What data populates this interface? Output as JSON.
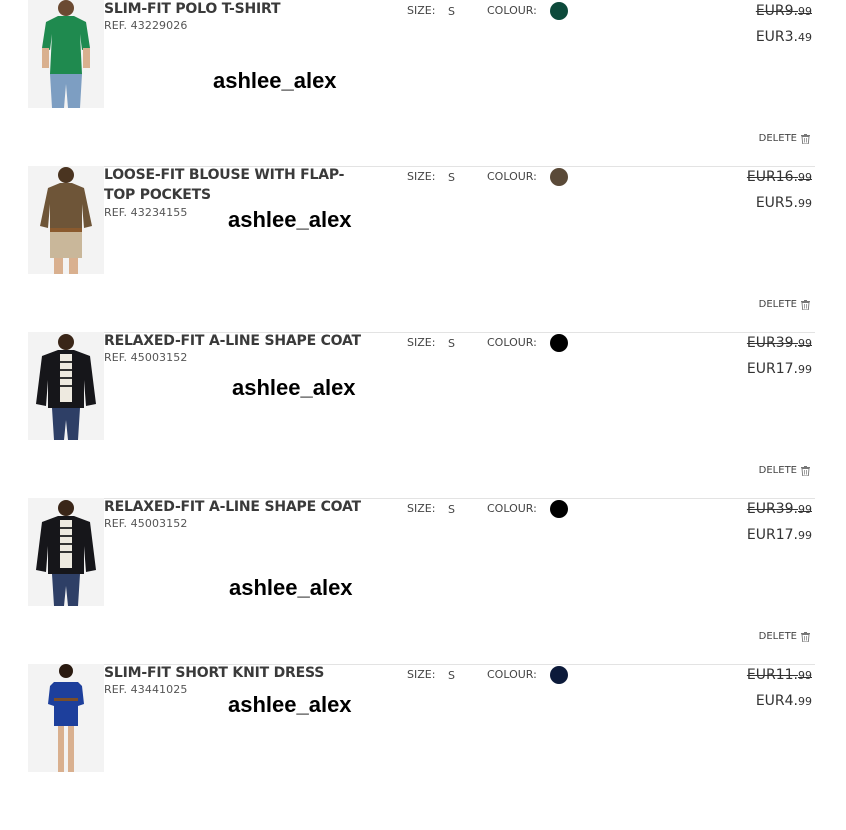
{
  "watermark": "ashlee_alex",
  "labels": {
    "size": "SIZE:",
    "colour": "COLOUR:",
    "delete": "DELETE"
  },
  "items": [
    {
      "name": "SLIM-FIT POLO T-SHIRT",
      "ref": "REF. 43229026",
      "size": "S",
      "colour": "#0d4a3b",
      "old_price_main": "EUR9.",
      "old_price_cents": "99",
      "new_price_main": "EUR3.",
      "new_price_cents": "49"
    },
    {
      "name": "LOOSE-FIT BLOUSE WITH FLAP-TOP POCKETS",
      "ref": "REF. 43234155",
      "size": "S",
      "colour": "#5a4a38",
      "old_price_main": "EUR16.",
      "old_price_cents": "99",
      "new_price_main": "EUR5.",
      "new_price_cents": "99"
    },
    {
      "name": "RELAXED-FIT A-LINE SHAPE COAT",
      "ref": "REF. 45003152",
      "size": "S",
      "colour": "#000000",
      "old_price_main": "EUR39.",
      "old_price_cents": "99",
      "new_price_main": "EUR17.",
      "new_price_cents": "99"
    },
    {
      "name": "RELAXED-FIT A-LINE SHAPE COAT",
      "ref": "REF. 45003152",
      "size": "S",
      "colour": "#000000",
      "old_price_main": "EUR39.",
      "old_price_cents": "99",
      "new_price_main": "EUR17.",
      "new_price_cents": "99"
    },
    {
      "name": "SLIM-FIT SHORT KNIT DRESS",
      "ref": "REF. 43441025",
      "size": "S",
      "colour": "#0c1a3a",
      "old_price_main": "EUR11.",
      "old_price_cents": "99",
      "new_price_main": "EUR4.",
      "new_price_cents": "99"
    }
  ]
}
